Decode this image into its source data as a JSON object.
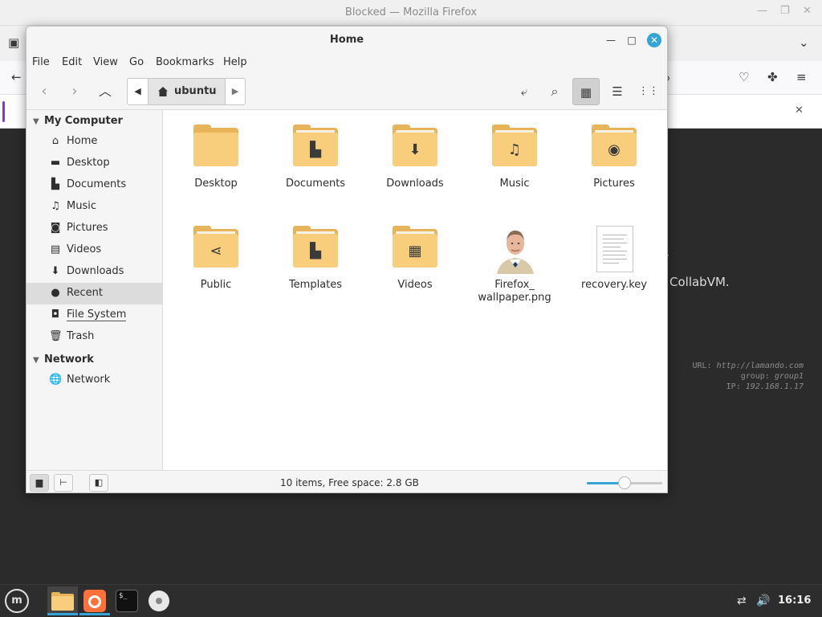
{
  "firefox": {
    "title": "Blocked — Mozilla Firefox",
    "collab_text": "CollabVM.",
    "info": {
      "url_label": "URL:",
      "url_value": "http://lamando.com",
      "group_label": "group:",
      "group_value": "group1",
      "ip_label": "IP:",
      "ip_value": "192.168.1.17"
    }
  },
  "nemo": {
    "title": "Home",
    "menu": [
      "File",
      "Edit",
      "View",
      "Go",
      "Bookmarks",
      "Help"
    ],
    "path_crumb": "ubuntu",
    "sidebar": {
      "my_computer_header": "My Computer",
      "items": [
        {
          "label": "Home",
          "icon": "house-icon"
        },
        {
          "label": "Desktop",
          "icon": "desktop-icon"
        },
        {
          "label": "Documents",
          "icon": "document-icon"
        },
        {
          "label": "Music",
          "icon": "music-icon"
        },
        {
          "label": "Pictures",
          "icon": "camera-icon"
        },
        {
          "label": "Videos",
          "icon": "film-icon"
        },
        {
          "label": "Downloads",
          "icon": "download-icon"
        },
        {
          "label": "Recent",
          "icon": "recent-icon"
        },
        {
          "label": "File System",
          "icon": "drive-icon"
        },
        {
          "label": "Trash",
          "icon": "trash-icon"
        }
      ],
      "network_header": "Network",
      "network_items": [
        {
          "label": "Network",
          "icon": "globe-icon"
        }
      ]
    },
    "files": [
      {
        "name": "Desktop",
        "type": "folder",
        "glyph": ""
      },
      {
        "name": "Documents",
        "type": "folder",
        "glyph": "▙"
      },
      {
        "name": "Downloads",
        "type": "folder",
        "glyph": "⬇"
      },
      {
        "name": "Music",
        "type": "folder",
        "glyph": "♫"
      },
      {
        "name": "Pictures",
        "type": "folder",
        "glyph": "◉"
      },
      {
        "name": "Public",
        "type": "folder",
        "glyph": "⋖"
      },
      {
        "name": "Templates",
        "type": "folder",
        "glyph": "▙"
      },
      {
        "name": "Videos",
        "type": "folder",
        "glyph": "▦"
      },
      {
        "name": "Firefox_\nwallpaper.png",
        "type": "image",
        "glyph": ""
      },
      {
        "name": "recovery.key",
        "type": "document",
        "glyph": ""
      }
    ],
    "status": "10 items, Free space: 2.8 GB",
    "zoom_level": 0.5
  },
  "taskbar": {
    "clock": "16:16"
  },
  "colors": {
    "accent": "#35a4d6",
    "folder": "#f8cd7c"
  }
}
